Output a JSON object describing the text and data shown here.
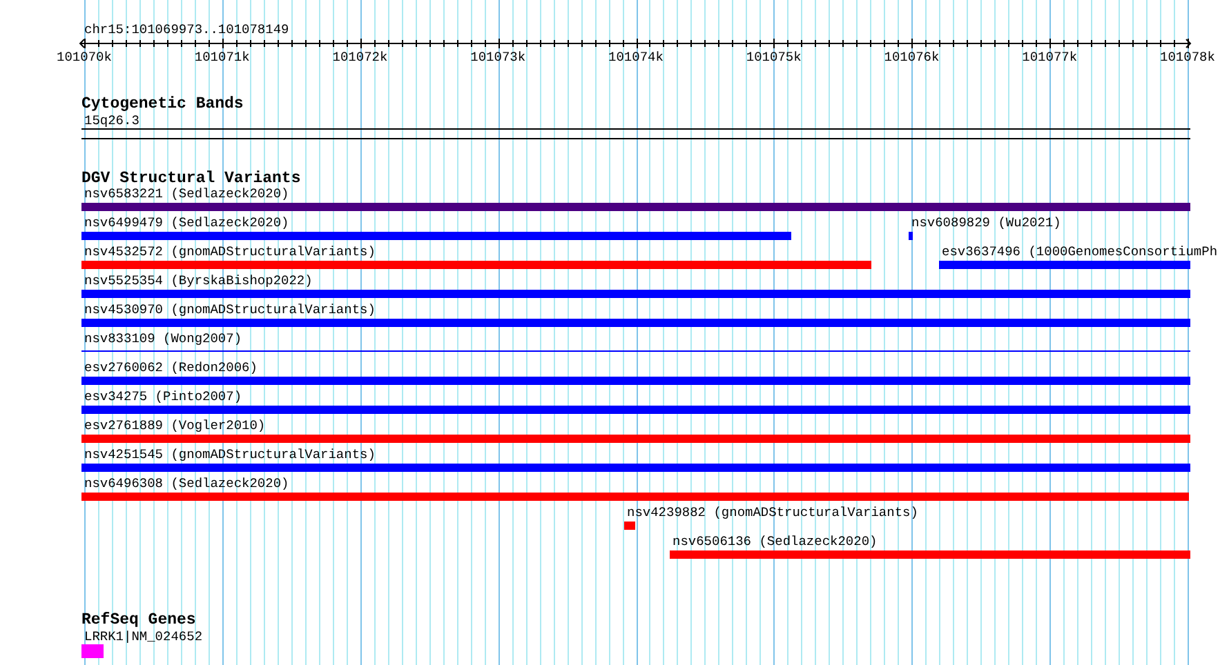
{
  "ruler": {
    "title": "chr15:101069973..101078149",
    "ticks": [
      "101070k",
      "101071k",
      "101072k",
      "101073k",
      "101074k",
      "101075k",
      "101076k",
      "101077k",
      "101078k"
    ]
  },
  "tracks": [
    {
      "title": "Cytogenetic Bands",
      "lanes": [
        {
          "features": [
            {
              "kind": "band",
              "label": "15q26.3"
            }
          ]
        }
      ]
    },
    {
      "title": "DGV Structural Variants",
      "lanes": [
        {
          "features": [
            {
              "kind": "bar",
              "label": "nsv6583221 (Sedlazeck2020)",
              "color": "#4b0082"
            }
          ]
        },
        {
          "features": [
            {
              "kind": "bar",
              "label": "nsv6499479 (Sedlazeck2020)",
              "color": "#0000ff"
            },
            {
              "kind": "bar",
              "label": "nsv6089829 (Wu2021)",
              "color": "#0000ff"
            }
          ]
        },
        {
          "features": [
            {
              "kind": "bar",
              "label": "nsv4532572 (gnomADStructuralVariants)",
              "color": "#ff0000"
            },
            {
              "kind": "bar",
              "label": "esv3637496 (1000GenomesConsortiumPh",
              "color": "#0000ff"
            }
          ]
        },
        {
          "features": [
            {
              "kind": "bar",
              "label": "nsv5525354 (ByrskaBishop2022)",
              "color": "#0000ff"
            }
          ]
        },
        {
          "features": [
            {
              "kind": "bar",
              "label": "nsv4530970 (gnomADStructuralVariants)",
              "color": "#0000ff"
            }
          ]
        },
        {
          "features": [
            {
              "kind": "line",
              "label": "nsv833109 (Wong2007)",
              "color": "#0000ff"
            }
          ]
        },
        {
          "features": [
            {
              "kind": "bar",
              "label": "esv2760062 (Redon2006)",
              "color": "#0000ff"
            }
          ]
        },
        {
          "features": [
            {
              "kind": "bar",
              "label": "esv34275 (Pinto2007)",
              "color": "#0000ff"
            }
          ]
        },
        {
          "features": [
            {
              "kind": "bar",
              "label": "esv2761889 (Vogler2010)",
              "color": "#ff0000"
            }
          ]
        },
        {
          "features": [
            {
              "kind": "bar",
              "label": "nsv4251545 (gnomADStructuralVariants)",
              "color": "#0000ff"
            }
          ]
        },
        {
          "features": [
            {
              "kind": "bar",
              "label": "nsv6496308 (Sedlazeck2020)",
              "color": "#ff0000"
            }
          ]
        },
        {
          "features": [
            {
              "kind": "bar",
              "label": "nsv4239882 (gnomADStructuralVariants)",
              "color": "#ff0000"
            }
          ]
        },
        {
          "features": [
            {
              "kind": "bar",
              "label": "nsv6506136 (Sedlazeck2020)",
              "color": "#ff0000"
            }
          ]
        }
      ]
    },
    {
      "title": "RefSeq Genes",
      "lanes": [
        {
          "features": [
            {
              "kind": "gene",
              "label": "LRRK1|NM_024652",
              "color": "#ff00ff"
            }
          ]
        }
      ]
    }
  ]
}
